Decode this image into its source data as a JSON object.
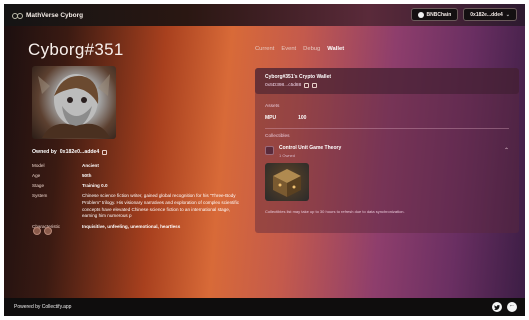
{
  "app": {
    "name": "MathVerse Cyborg"
  },
  "header": {
    "chain_label": "BNBChain",
    "wallet_label": "0x182e...dde4"
  },
  "profile": {
    "title": "Cyborg#351",
    "owner_prefix": "Owned by",
    "owner_address": "0x182e0...adde4",
    "props": [
      {
        "key": "Model",
        "value": "Ancient"
      },
      {
        "key": "Age",
        "value": "50th"
      },
      {
        "key": "Stage",
        "value": "Training 0.0"
      },
      {
        "key": "System",
        "value": "Chinese science fiction writer, gained global recognition for his \"Three-Body Problem\" trilogy. His visionary narratives and exploration of complex scientific concepts have elevated Chinese science fiction to an international stage, earning him numerous p"
      },
      {
        "key": "Characteristic",
        "value": "Inquisitive, unfeeling, unemotional, heartless"
      }
    ]
  },
  "tabs": [
    {
      "label": "Current",
      "active": false
    },
    {
      "label": "Event",
      "active": false
    },
    {
      "label": "Debug",
      "active": false
    },
    {
      "label": "Wallet",
      "active": true
    }
  ],
  "wallet": {
    "title": "Cyborg#351's Crypto Wallet",
    "address": "0x5D398...c5d88",
    "assets_label": "Assets",
    "asset_symbol": "MPU",
    "asset_amount": "100",
    "collectibles_label": "Collectibles",
    "collection_name": "Control Unit Game Theory",
    "collection_sub": "1 Owned",
    "note": "Collectibles list may take up to 30 hours to refresh due to data synchronization."
  },
  "footer": {
    "powered_by": "Powered by Collectify.app"
  },
  "colors": {
    "topbar_bg": "#141414",
    "footer_bg": "#0f0d0d",
    "accent_gradient_mid": "#d86a38",
    "accent_gradient_end": "#6a2f62"
  },
  "icons": {
    "brand": "infinity-icon",
    "chain": "bnb-dot-icon",
    "copy": "copy-icon",
    "external": "external-link-icon",
    "chevron": "chevron-up-icon",
    "twitter": "twitter-icon",
    "discord": "discord-icon"
  }
}
